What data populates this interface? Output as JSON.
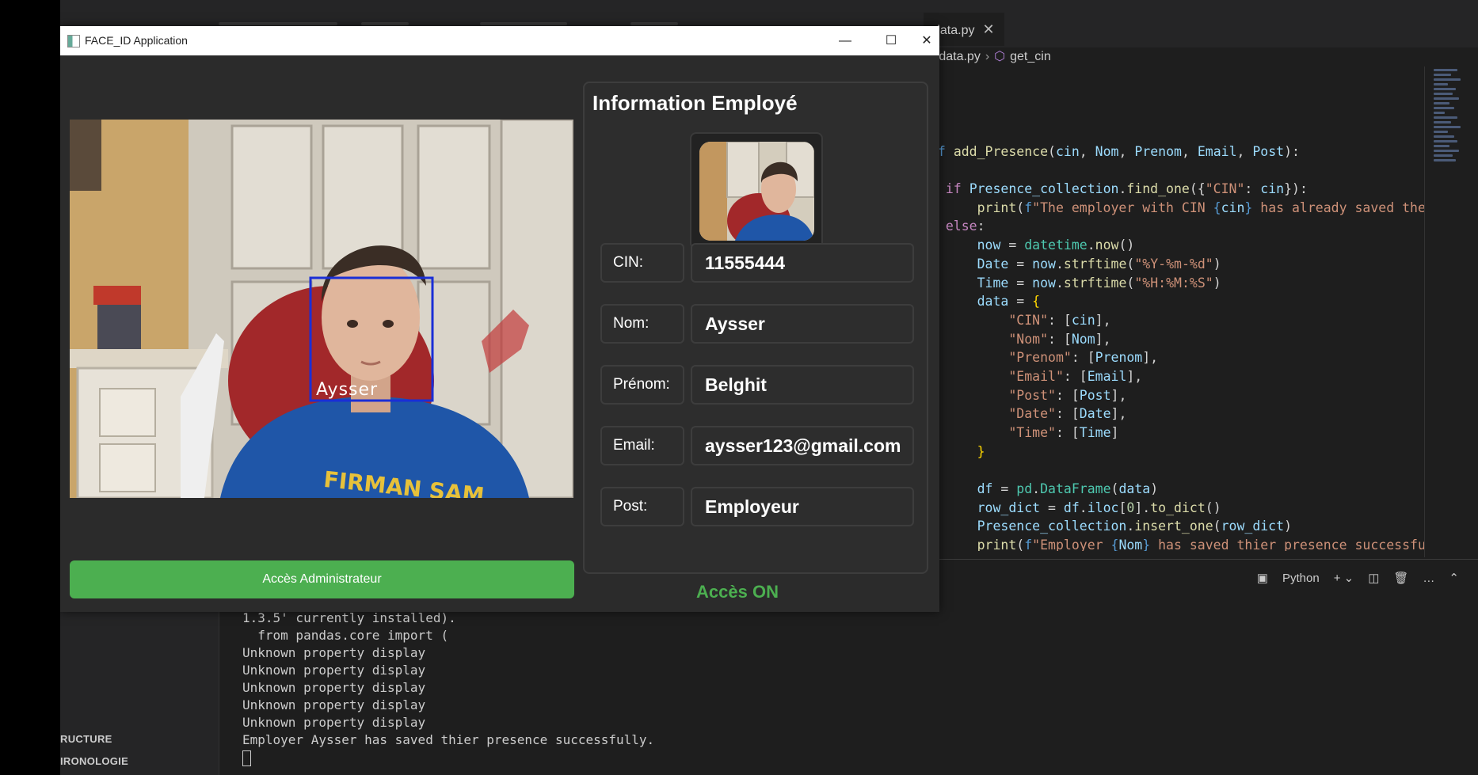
{
  "editor": {
    "tab_file": "data.py",
    "breadcrumb_file": "t_data.py",
    "breadcrumb_symbol": "get_cin",
    "terminal_language": "Python",
    "terminal_lines": [
      "1.3.5' currently installed).",
      "  from pandas.core import (",
      "Unknown property display",
      "Unknown property display",
      "Unknown property display",
      "Unknown property display",
      "Unknown property display",
      "Employer Aysser has saved thier presence successfully."
    ],
    "sidebar_sections": [
      "RUCTURE",
      "IRONOLOGIE"
    ]
  },
  "app": {
    "window_title": "FACE_ID Application",
    "camera_face_label": "Aysser",
    "admin_button": "Accès Administrateur",
    "status": "Accès ON",
    "status_color": "#4caf50",
    "info": {
      "title": "Information Employé",
      "fields": [
        {
          "label": "CIN:",
          "value": "11555444"
        },
        {
          "label": "Nom:",
          "value": "Aysser"
        },
        {
          "label": "Prénom:",
          "value": "Belghit"
        },
        {
          "label": "Email:",
          "value": "aysser123@gmail.com"
        },
        {
          "label": "Post:",
          "value": "Employeur"
        }
      ]
    }
  }
}
